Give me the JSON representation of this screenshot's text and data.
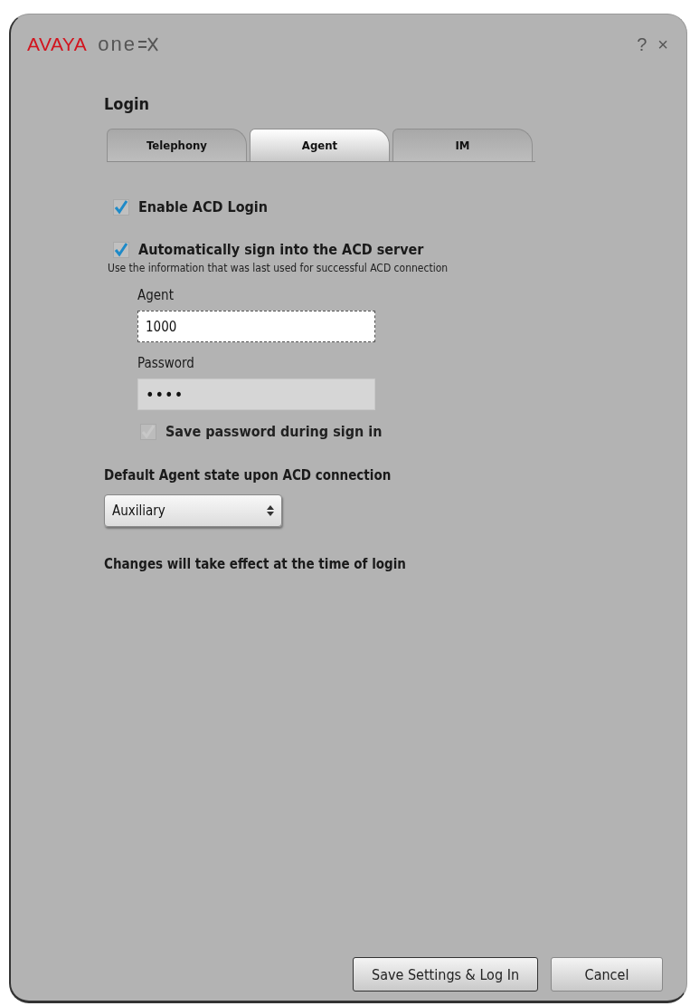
{
  "window": {
    "brand": "AVAYA",
    "product": "one",
    "help": "?",
    "close": "×"
  },
  "heading": "Login",
  "tabs": [
    {
      "label": "Telephony",
      "selected": false
    },
    {
      "label": "Agent",
      "selected": true
    },
    {
      "label": "IM",
      "selected": false
    }
  ],
  "enable_acd": {
    "label": "Enable ACD Login",
    "checked": true,
    "disabled": false
  },
  "auto_sign_in": {
    "label": "Automatically sign into the ACD server",
    "checked": true,
    "disabled": false,
    "hint": "Use the information that was last used for successful ACD connection"
  },
  "agent": {
    "label": "Agent",
    "value": "1000",
    "focused": true
  },
  "password": {
    "label": "Password",
    "value": "••••",
    "disabled": true
  },
  "save_password": {
    "label": "Save password during sign in",
    "checked": true,
    "disabled": true
  },
  "default_state": {
    "label": "Default Agent state upon ACD connection",
    "value": "Auxiliary"
  },
  "note": "Changes will take effect at the time of login",
  "buttons": [
    {
      "label": "Save Settings & Log In",
      "kind": "default"
    },
    {
      "label": "Cancel",
      "kind": "normal"
    }
  ]
}
